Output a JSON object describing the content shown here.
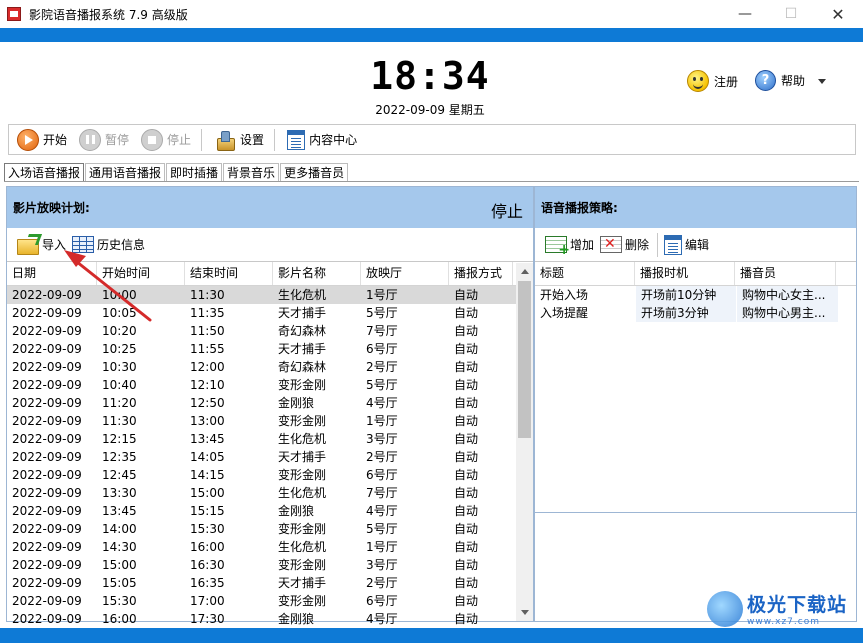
{
  "window": {
    "title": "影院语音播报系统 7.9 高级版",
    "controls": {
      "minimize": "—",
      "maximize": "☐",
      "close": "✕"
    }
  },
  "header": {
    "clock": "18:34",
    "date": "2022-09-09 星期五",
    "register_label": "注册",
    "help_label": "帮助"
  },
  "toolbar": {
    "start_label": "开始",
    "pause_label": "暂停",
    "stop_label": "停止",
    "settings_label": "设置",
    "content_label": "内容中心"
  },
  "tabs": [
    {
      "label": "入场语音播报",
      "active": true
    },
    {
      "label": "通用语音播报",
      "active": false
    },
    {
      "label": "即时插播",
      "active": false
    },
    {
      "label": "背景音乐",
      "active": false
    },
    {
      "label": "更多播音员",
      "active": false
    }
  ],
  "schedule": {
    "title": "影片放映计划:",
    "status": "停止",
    "import_label": "导入",
    "history_label": "历史信息",
    "columns": [
      "日期",
      "开始时间",
      "结束时间",
      "影片名称",
      "放映厅",
      "播报方式"
    ],
    "rows": [
      [
        "2022-09-09",
        "10:00",
        "11:30",
        "生化危机",
        "1号厅",
        "自动"
      ],
      [
        "2022-09-09",
        "10:05",
        "11:35",
        "天才捕手",
        "5号厅",
        "自动"
      ],
      [
        "2022-09-09",
        "10:20",
        "11:50",
        "奇幻森林",
        "7号厅",
        "自动"
      ],
      [
        "2022-09-09",
        "10:25",
        "11:55",
        "天才捕手",
        "6号厅",
        "自动"
      ],
      [
        "2022-09-09",
        "10:30",
        "12:00",
        "奇幻森林",
        "2号厅",
        "自动"
      ],
      [
        "2022-09-09",
        "10:40",
        "12:10",
        "变形金刚",
        "5号厅",
        "自动"
      ],
      [
        "2022-09-09",
        "11:20",
        "12:50",
        "金刚狼",
        "4号厅",
        "自动"
      ],
      [
        "2022-09-09",
        "11:30",
        "13:00",
        "变形金刚",
        "1号厅",
        "自动"
      ],
      [
        "2022-09-09",
        "12:15",
        "13:45",
        "生化危机",
        "3号厅",
        "自动"
      ],
      [
        "2022-09-09",
        "12:35",
        "14:05",
        "天才捕手",
        "2号厅",
        "自动"
      ],
      [
        "2022-09-09",
        "12:45",
        "14:15",
        "变形金刚",
        "6号厅",
        "自动"
      ],
      [
        "2022-09-09",
        "13:30",
        "15:00",
        "生化危机",
        "7号厅",
        "自动"
      ],
      [
        "2022-09-09",
        "13:45",
        "15:15",
        "金刚狼",
        "4号厅",
        "自动"
      ],
      [
        "2022-09-09",
        "14:00",
        "15:30",
        "变形金刚",
        "5号厅",
        "自动"
      ],
      [
        "2022-09-09",
        "14:30",
        "16:00",
        "生化危机",
        "1号厅",
        "自动"
      ],
      [
        "2022-09-09",
        "15:00",
        "16:30",
        "变形金刚",
        "3号厅",
        "自动"
      ],
      [
        "2022-09-09",
        "15:05",
        "16:35",
        "天才捕手",
        "2号厅",
        "自动"
      ],
      [
        "2022-09-09",
        "15:30",
        "17:00",
        "变形金刚",
        "6号厅",
        "自动"
      ],
      [
        "2022-09-09",
        "16:00",
        "17:30",
        "金刚狼",
        "4号厅",
        "自动"
      ]
    ]
  },
  "strategy": {
    "title": "语音播报策略:",
    "add_label": "增加",
    "delete_label": "删除",
    "edit_label": "编辑",
    "columns": [
      "标题",
      "播报时机",
      "播音员"
    ],
    "rows": [
      [
        "开始入场",
        "开场前10分钟",
        "购物中心女主..."
      ],
      [
        "入场提醒",
        "开场前3分钟",
        "购物中心男主..."
      ]
    ]
  },
  "watermark": {
    "title": "极光下载站",
    "url": "www.xz7.com"
  },
  "colors": {
    "accent_blue": "#0e7ad6",
    "panel_header": "#a5c8ec",
    "annotation_arrow": "#d42a2a"
  }
}
